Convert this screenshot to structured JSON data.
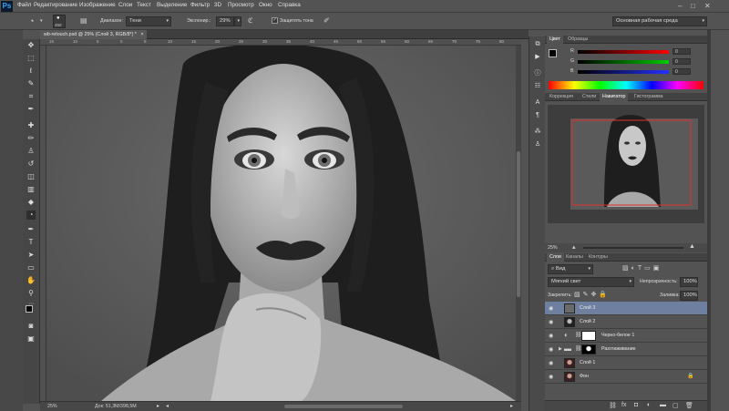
{
  "app": {
    "logo": "Ps"
  },
  "menu": [
    "Файл",
    "Редактирование",
    "Изображение",
    "Слои",
    "Текст",
    "Выделение",
    "Фильтр",
    "3D",
    "Просмотр",
    "Окно",
    "Справка"
  ],
  "window_controls": [
    "–",
    "□",
    "✕"
  ],
  "options": {
    "brush_size": "450",
    "range_label": "Диапазон:",
    "range_value": "Тени",
    "exposure_label": "Экспонир.:",
    "exposure_value": "29%",
    "protect_tones": "Защитить тона",
    "workspace": "Основная рабочая среда"
  },
  "document": {
    "tab_title": "wb-retouch.psd @ 25% (Слой 3, RGB/8*) *",
    "close": "×"
  },
  "ruler": [
    "15",
    "10",
    "5",
    "0",
    "5",
    "10",
    "15",
    "20",
    "25",
    "30",
    "35",
    "40",
    "45",
    "50",
    "55",
    "60",
    "65",
    "70",
    "75",
    "80"
  ],
  "status": {
    "zoom": "25%",
    "doc_size": "Док: 51,3M/398,5M"
  },
  "color_panel": {
    "tabs": [
      "Цвет",
      "Образцы"
    ],
    "channels": [
      {
        "label": "R",
        "value": "0"
      },
      {
        "label": "G",
        "value": "0"
      },
      {
        "label": "B",
        "value": "0"
      }
    ]
  },
  "nav_panel": {
    "tabs": [
      "Коррекция",
      "Стили",
      "Навигатор",
      "Гистограмма"
    ],
    "zoom": "25%"
  },
  "layers_panel": {
    "tabs": [
      "Слои",
      "Каналы",
      "Контуры"
    ],
    "filter": "Вид",
    "blend_mode": "Мягкий свет",
    "opacity_label": "Непрозрачность:",
    "opacity": "100%",
    "lock_label": "Закрепить:",
    "fill_label": "Заливка:",
    "fill": "100%",
    "layers": [
      {
        "name": "Слой 3",
        "selected": true
      },
      {
        "name": "Слой 2",
        "selected": false
      },
      {
        "name": "Черно-белое 1",
        "selected": false
      },
      {
        "name": "Разглаживание",
        "selected": false
      },
      {
        "name": "Слой 1",
        "selected": false
      },
      {
        "name": "Фон",
        "selected": false
      }
    ]
  },
  "colors": {
    "accent": "#31a8ff",
    "nav_frame": "#e03030",
    "selected_layer": "#6f7fa0"
  }
}
